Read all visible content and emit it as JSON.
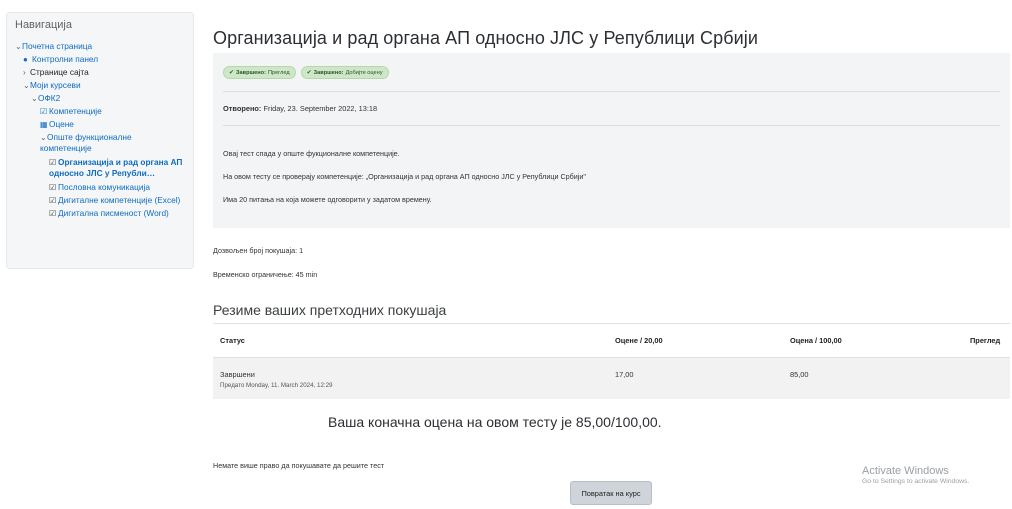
{
  "nav": {
    "title": "Навигација",
    "home": "Почетна страница",
    "dashboard": "Контролни панел",
    "site_pages": "Странице сајта",
    "my_courses": "Моји курсеви",
    "course": "ОФК2",
    "competencies": "Компетенције",
    "grades": "Оцене",
    "section": "Опште функционалне компетенције",
    "items": [
      {
        "label": "Организација и рад органа АП односно ЈЛС у Републи…",
        "active": true
      },
      {
        "label": "Пословна комуникација",
        "active": false
      },
      {
        "label": "Дигиталне компетенције (Excel)",
        "active": false
      },
      {
        "label": "Дигитална писменост (Word)",
        "active": false
      }
    ]
  },
  "page": {
    "title": "Организација и рад органа АП односно ЈЛС у Републици Србији"
  },
  "completion": {
    "badge1_strong": "Завршено:",
    "badge1_text": "Преглед",
    "badge2_strong": "Завршено:",
    "badge2_text": "Добијте оцену"
  },
  "opened": {
    "label": "Отворено:",
    "value": "Friday, 23. September 2022, 13:18"
  },
  "description": [
    "Овај тест спада у опште фукционалне компетенције.",
    "На овом тесту се проверају компетенције: „Организација и рад органа АП односно ЈЛС у Републици Србији\"",
    "Има 20 питања на која можете одговорити у задатом времену."
  ],
  "meta": {
    "attempts": "Дозвољен број покушаја: 1",
    "time_limit": "Временско ограничење: 45 min"
  },
  "summary": {
    "title": "Резиме ваших претходних покушаја",
    "headers": [
      "Статус",
      "Оцене / 20,00",
      "Оцена / 100,00",
      "Преглед"
    ],
    "rows": [
      {
        "status": "Завршени",
        "submitted": "Предато Monday, 11. March 2024, 12:29",
        "marks": "17,00",
        "grade": "85,00",
        "review": ""
      }
    ]
  },
  "final_grade": "Ваша коначна оцена на овом тесту је 85,00/100,00.",
  "no_more_attempts": "Немате више право да покушавате да решите тест",
  "back_button": "Повратак на курс",
  "watermark": {
    "line1": "Activate Windows",
    "line2": "Go to Settings to activate Windows."
  }
}
